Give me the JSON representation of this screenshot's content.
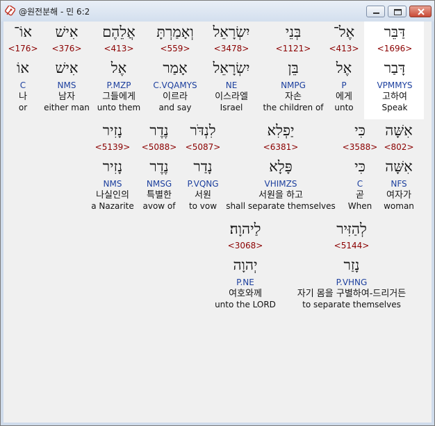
{
  "window": {
    "title": "@원전분해 - 민 6:2"
  },
  "colors": {
    "strong": "#8b0000",
    "morph": "#1c3f9e",
    "highlight": "#ffffff",
    "background": "#f0f0f0"
  },
  "icons": {
    "app": "app-logo-icon",
    "minimize": "minimize-icon",
    "maximize": "maximize-icon",
    "close": "close-icon"
  },
  "rows": [
    [
      {
        "heb": "דַּבֵּר",
        "strong": "<1696>",
        "lemma": "דָּבַר",
        "morph": "VPMMYS",
        "kor": "고하여",
        "eng": "Speak",
        "highlighted": true
      },
      {
        "heb": "אֶל־",
        "strong": "<413>",
        "lemma": "אֶל",
        "morph": "P",
        "kor": "에게",
        "eng": "unto"
      },
      {
        "heb": "בְּנֵי",
        "strong": "<1121>",
        "lemma": "בֵּן",
        "morph": "NMPG",
        "kor": "자손",
        "eng": "the children of"
      },
      {
        "heb": "יִשְׂרָאֵל",
        "strong": "<3478>",
        "lemma": "יִשְׂרָאֵל",
        "morph": "NE",
        "kor": "이스라엘",
        "eng": "Israel"
      },
      {
        "heb": "וְאָמַרְתָּ",
        "strong": "<559>",
        "lemma": "אָמַר",
        "morph": "C.VQAMYS",
        "kor": "이르라",
        "eng": "and say"
      },
      {
        "heb": "אֲלֵהֶם",
        "strong": "<413>",
        "lemma": "אֶל",
        "morph": "P.MZP",
        "kor": "그들에게",
        "eng": "unto them"
      },
      {
        "heb": "אִישׁ",
        "strong": "<376>",
        "lemma": "אִישׁ",
        "morph": "NMS",
        "kor": "남자",
        "eng": "either man"
      },
      {
        "heb": "אוֹ־",
        "strong": "<176>",
        "lemma": "אוֹ",
        "morph": "C",
        "kor": "나",
        "eng": "or"
      }
    ],
    [
      {
        "heb": "אִשָּׁה",
        "strong": "<802>",
        "lemma": "אִשָּׁה",
        "morph": "NFS",
        "kor": "여자가",
        "eng": "woman"
      },
      {
        "heb": "כִּי",
        "strong": "<3588>",
        "lemma": "כִּי",
        "morph": "C",
        "kor": "곧",
        "eng": "When"
      },
      {
        "heb": "יַפְלִא",
        "strong": "<6381>",
        "lemma": "פָּלָא",
        "morph": "VHIMZS",
        "kor": "서원을 하고",
        "eng": "shall separate themselves"
      },
      {
        "heb": "לִנְדֹּר",
        "strong": "<5087>",
        "lemma": "נָדַר",
        "morph": "P.VQNG",
        "kor": "서원",
        "eng": "to vow"
      },
      {
        "heb": "נֶדֶר",
        "strong": "<5088>",
        "lemma": "נֶדֶר",
        "morph": "NMSG",
        "kor": "특별한",
        "eng": "avow of"
      },
      {
        "heb": "נָזִיר",
        "strong": "<5139>",
        "lemma": "נָזִיר",
        "morph": "NMS",
        "kor": "나실인의",
        "eng": "a Nazarite"
      }
    ],
    [
      {
        "heb": "לְהַזִּיר",
        "strong": "<5144>",
        "lemma": "נָזַר",
        "morph": "P.VHNG",
        "kor": "자기 몸을 구별하여-드리거든",
        "eng": "to separate themselves"
      },
      {
        "heb": "לַיהוָה׃",
        "strong": "<3068>",
        "lemma": "יְהוָה",
        "morph": "P.NE",
        "kor": "여호와께",
        "eng": "unto the LORD"
      }
    ]
  ]
}
